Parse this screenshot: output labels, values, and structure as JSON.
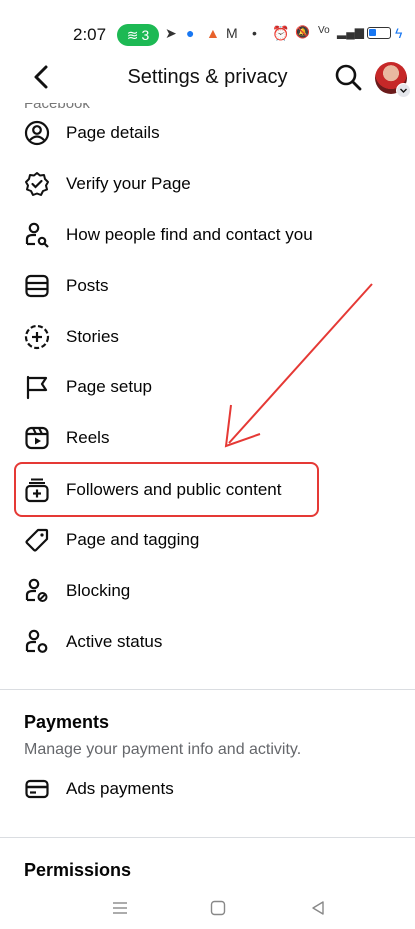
{
  "status_bar": {
    "time": "2:07",
    "wifi_badge": "3",
    "icons": [
      "telegram-icon",
      "messenger-icon",
      "app-icon",
      "gmail-icon",
      "dot-icon",
      "alarm-icon",
      "mute-icon",
      "volte-icon",
      "signal-icon",
      "battery-icon"
    ]
  },
  "header": {
    "title": "Settings & privacy"
  },
  "cut_text": "Facebook",
  "items": [
    {
      "label": "Page details",
      "icon": "person-circle-icon"
    },
    {
      "label": "Verify your Page",
      "icon": "verified-badge-icon"
    },
    {
      "label": "How people find and contact you",
      "icon": "person-search-icon"
    },
    {
      "label": "Posts",
      "icon": "posts-icon"
    },
    {
      "label": "Stories",
      "icon": "stories-plus-icon"
    },
    {
      "label": "Page setup",
      "icon": "flag-icon"
    },
    {
      "label": "Reels",
      "icon": "reels-icon"
    },
    {
      "label": "Followers and public content",
      "icon": "followers-content-icon"
    },
    {
      "label": "Page and tagging",
      "icon": "tag-icon"
    },
    {
      "label": "Blocking",
      "icon": "person-block-icon"
    },
    {
      "label": "Active status",
      "icon": "person-active-icon"
    }
  ],
  "payments": {
    "title": "Payments",
    "subtitle": "Manage your payment info and activity.",
    "item_label": "Ads payments"
  },
  "permissions": {
    "title": "Permissions"
  },
  "accent_color": "#e53935"
}
